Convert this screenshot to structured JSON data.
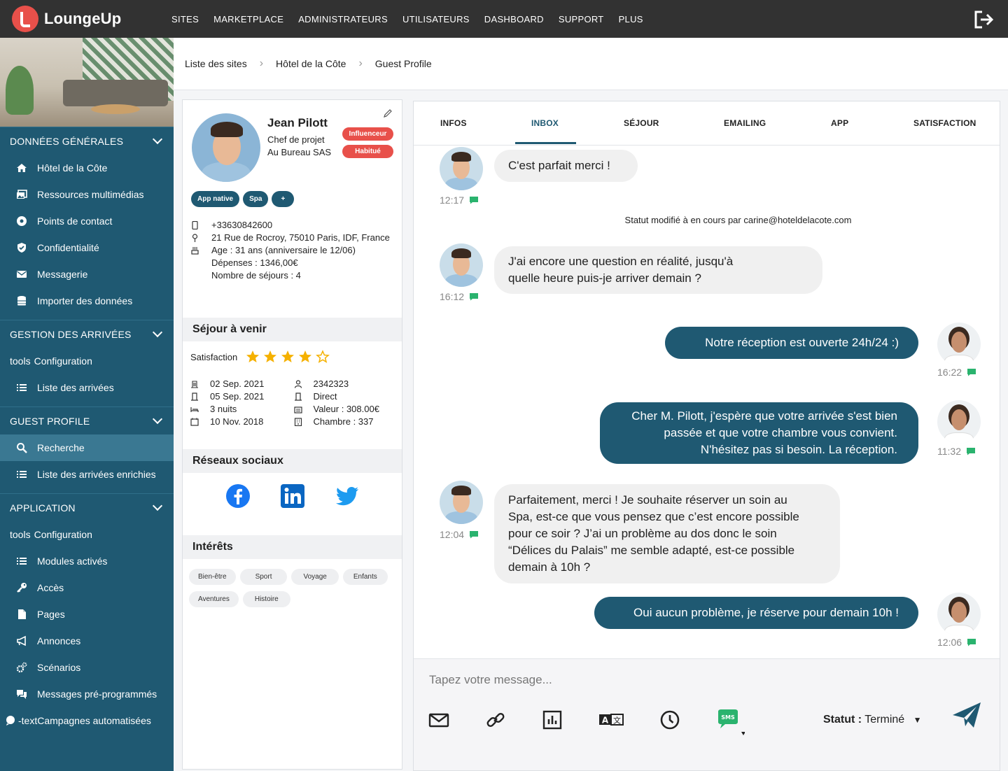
{
  "app": {
    "name": "LoungeUp"
  },
  "topnav": [
    "SITES",
    "MARKETPLACE",
    "ADMINISTRATEURS",
    "UTILISATEURS",
    "DASHBOARD",
    "SUPPORT",
    "PLUS"
  ],
  "sidebar": {
    "sections": [
      {
        "title": "DONNÉES GÉNÉRALES",
        "items": [
          "Hôtel de la Côte",
          "Ressources multimédias",
          "Points de contact",
          "Confidentialité",
          "Messagerie",
          "Importer des données"
        ]
      },
      {
        "title": "GESTION DES ARRIVÉES",
        "items": [
          "Configuration",
          "Liste des arrivées"
        ]
      },
      {
        "title": "GUEST PROFILE",
        "items": [
          "Recherche",
          "Liste des arrivées enrichies"
        ]
      },
      {
        "title": "APPLICATION",
        "items": [
          "Configuration",
          "Modules activés",
          "Accès",
          "Pages",
          "Annonces",
          "Scénarios",
          "Messages pré-programmés",
          "Campagnes automatisées"
        ]
      }
    ],
    "tools_prefix": "tools",
    "campaign_prefix": "-text"
  },
  "breadcrumb": [
    "Liste des sites",
    "Hôtel de la Côte",
    "Guest Profile"
  ],
  "profile": {
    "name": "Jean Pilott",
    "role": "Chef de projet",
    "company": "Au Bureau SAS",
    "badges": [
      "Influenceur",
      "Habitué"
    ],
    "tags": [
      "App native",
      "Spa",
      "+"
    ],
    "phone": "+33630842600",
    "address": "21 Rue de Rocroy, 75010 Paris, IDF, France",
    "age": "Age : 31 ans (anniversaire le 12/06)",
    "spend": "Dépenses : 1346,00€",
    "stays": "Nombre de séjours : 4",
    "upcoming_title": "Séjour à venir",
    "satisfaction_label": "Satisfaction",
    "satisfaction_stars": 4,
    "stay_left": [
      "02 Sep. 2021",
      "05 Sep. 2021",
      "3 nuits",
      "10 Nov. 2018"
    ],
    "stay_right": [
      "2342323",
      "Direct",
      "Valeur : 308.00€",
      "Chambre : 337"
    ],
    "social_title": "Réseaux sociaux",
    "interests_title": "Intérêts",
    "interests": [
      "Bien-être",
      "Sport",
      "Voyage",
      "Enfants",
      "Aventures",
      "Histoire"
    ]
  },
  "tabs": [
    "INFOS",
    "INBOX",
    "SÉJOUR",
    "EMAILING",
    "APP",
    "SATISFACTION"
  ],
  "active_tab": "INBOX",
  "messages": [
    {
      "dir": "in",
      "text": "C'est parfait merci !",
      "time": "12:17"
    },
    {
      "dir": "status",
      "text": "Statut modifié à en cours par carine@hoteldelacote.com"
    },
    {
      "dir": "in",
      "text": "J'ai encore une question en réalité, jusqu'à quelle heure puis-je arriver demain ?",
      "time": "16:12"
    },
    {
      "dir": "out",
      "text": "Notre réception est ouverte 24h/24 :)",
      "time": "16:22"
    },
    {
      "dir": "out",
      "text": "Cher M. Pilott, j'espère que votre arrivée s'est bien passée et que votre chambre vous convient. N'hésitez pas si besoin. La réception.",
      "time": "11:32"
    },
    {
      "dir": "in",
      "text": "Parfaitement, merci ! Je souhaite réserver un soin au Spa, est-ce que vous pensez que c’est encore possible pour ce soir ? J’ai un problème au dos donc le soin “Délices du Palais” me semble adapté, est-ce possible demain à 10h ?",
      "time": "12:04"
    },
    {
      "dir": "out",
      "text": "Oui aucun problème, je réserve pour demain 10h !",
      "time": "12:06"
    }
  ],
  "composer": {
    "placeholder": "Tapez votre message...",
    "status_label": "Statut :",
    "status_value": "Terminé",
    "sms_label": "SMS"
  },
  "colors": {
    "brand": "#1f5972",
    "accent": "#e8504a",
    "star": "#f5b100",
    "sms": "#2ab36e"
  }
}
